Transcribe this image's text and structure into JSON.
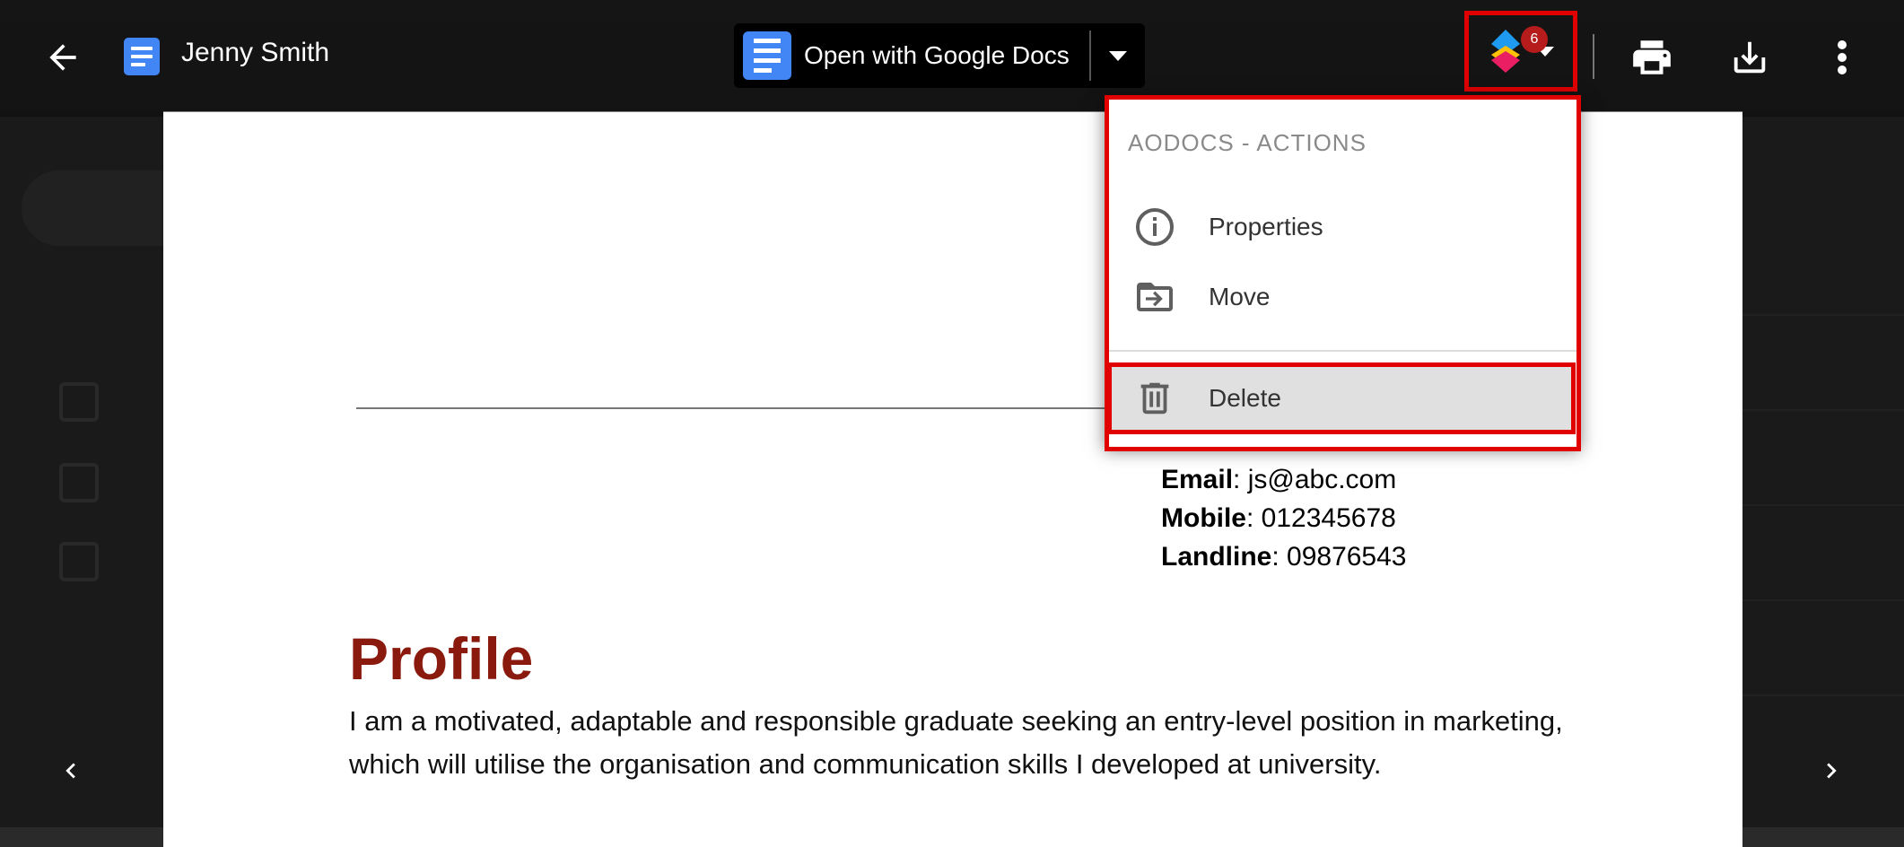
{
  "header": {
    "title": "Jenny Smith",
    "open_with_label": "Open with Google Docs"
  },
  "aodocs_menu": {
    "notification_count": "6",
    "section_title": "AODOCS - ACTIONS",
    "items": [
      {
        "label": "Properties",
        "icon": "info-icon"
      },
      {
        "label": "Move",
        "icon": "move-to-folder-icon"
      },
      {
        "label": "Delete",
        "icon": "trash-icon"
      }
    ]
  },
  "document": {
    "contact": [
      {
        "key": "Email",
        "value": ": js@abc.com"
      },
      {
        "key": "Mobile",
        "value": ": 012345678"
      },
      {
        "key": "Landline",
        "value": ": 09876543"
      }
    ],
    "heading": "Profile",
    "paragraph": "I am a motivated, adaptable and responsible graduate seeking an entry-level position in marketing, which will utilise the organisation and communication skills I developed at university."
  },
  "colors": {
    "highlight": "#e00000",
    "heading": "#8b1a0e",
    "docs_blue": "#4285f4"
  }
}
